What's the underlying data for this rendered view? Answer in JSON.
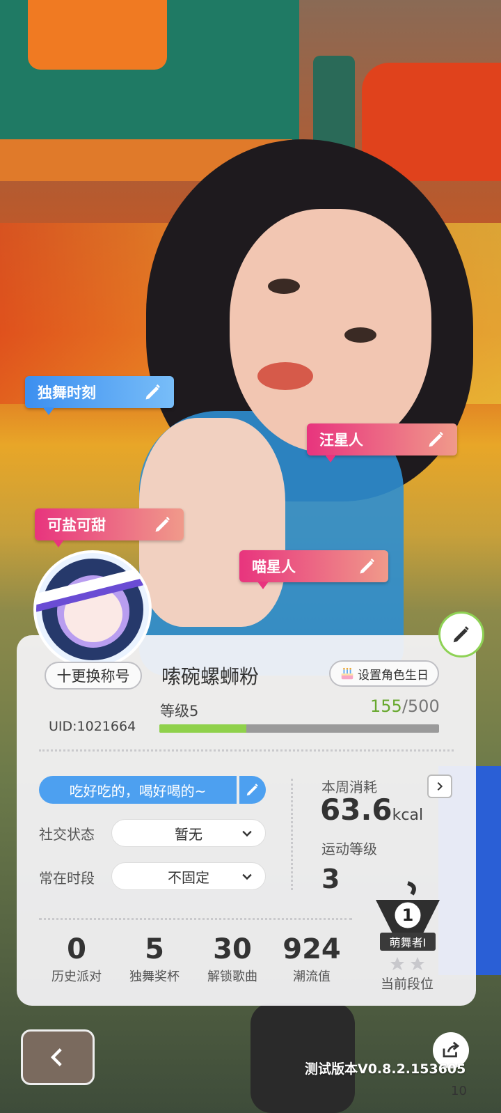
{
  "tags": [
    {
      "label": "独舞时刻",
      "color": "blue"
    },
    {
      "label": "汪星人",
      "color": "pink"
    },
    {
      "label": "可盐可甜",
      "color": "pink"
    },
    {
      "label": "喵星人",
      "color": "pink"
    }
  ],
  "profile": {
    "change_title_label": "十更换称号",
    "nickname": "嗦碗螺蛳粉",
    "birthday_button_label": "设置角色生日",
    "uid": "UID:1021664",
    "level_label": "等级5",
    "exp_current": "155",
    "exp_total": "/500",
    "exp_progress_fraction": 0.31,
    "signature": "吃好吃的，喝好喝的~",
    "social_status_label": "社交状态",
    "social_status_value": "暂无",
    "active_time_label": "常在时段",
    "active_time_value": "不固定"
  },
  "fitness": {
    "weekly_label": "本周消耗",
    "weekly_value": "63.6",
    "weekly_unit": "kcal",
    "sport_level_label": "运动等级",
    "sport_level_value": "3"
  },
  "stats": [
    {
      "value": "0",
      "label": "历史派对"
    },
    {
      "value": "5",
      "label": "独舞奖杯"
    },
    {
      "value": "30",
      "label": "解锁歌曲"
    },
    {
      "value": "924",
      "label": "潮流值"
    }
  ],
  "rank": {
    "badge_number": "1",
    "title": "萌舞者I",
    "stars_filled": 0,
    "stars_total": 2,
    "label": "当前段位"
  },
  "footer": {
    "version": "测试版本V0.8.2.153605",
    "corner_num": "10"
  },
  "colors": {
    "accent_blue": "#4da0f0",
    "tag_pink": "#e8347e",
    "exp_green": "#8fd14b"
  }
}
